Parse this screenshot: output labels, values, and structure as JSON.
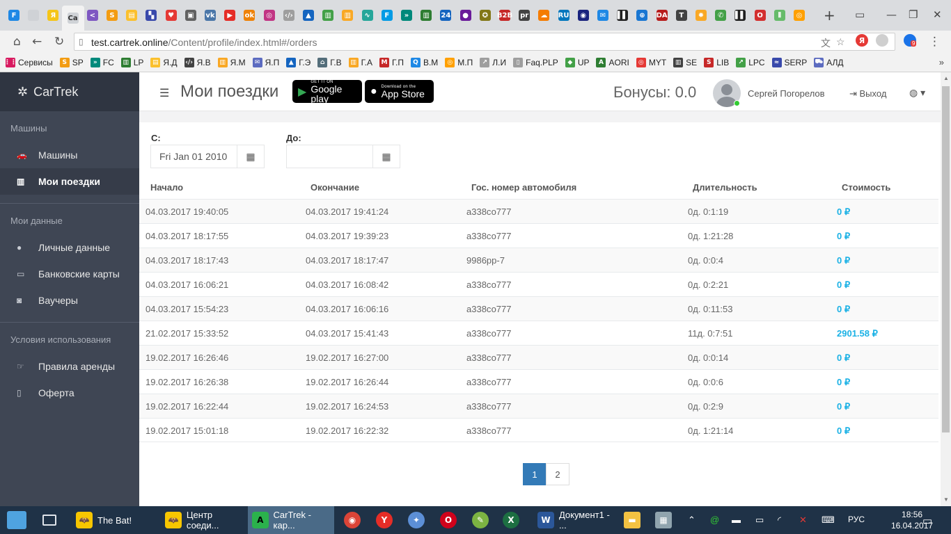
{
  "browser": {
    "url_host": "test.cartrek.online",
    "url_path": "/Content/profile/index.html#/orders",
    "active_tab_short": "Са",
    "tabs": [
      {
        "icon": "blue-square",
        "color": "#1e88e5",
        "g": "F"
      },
      {
        "icon": "page",
        "color": "#cfd2d6",
        "g": ""
      },
      {
        "icon": "yandex",
        "color": "#f5c518",
        "g": "Я"
      },
      {
        "icon": "cartrek",
        "color": "#cfd2d6",
        "g": "Са"
      },
      {
        "icon": "share",
        "color": "#7e57c2",
        "g": "<"
      },
      {
        "icon": "s-orange",
        "color": "#f39c12",
        "g": "S"
      },
      {
        "icon": "yellow-doc",
        "color": "#fbc02d",
        "g": "▤"
      },
      {
        "icon": "uploader",
        "color": "#3949ab",
        "g": "▚"
      },
      {
        "icon": "red-logo",
        "color": "#e53935",
        "g": "♥"
      },
      {
        "icon": "box",
        "color": "#616161",
        "g": "▣"
      },
      {
        "icon": "vk",
        "color": "#4a76a8",
        "g": "vk"
      },
      {
        "icon": "youtube",
        "color": "#e52d27",
        "g": "▶"
      },
      {
        "icon": "odnoklassniki",
        "color": "#ee8208",
        "g": "ok"
      },
      {
        "icon": "instagram",
        "color": "#c13584",
        "g": "◎"
      },
      {
        "icon": "code",
        "color": "#9e9e9e",
        "g": "‹/›"
      },
      {
        "icon": "triangle",
        "color": "#1565c0",
        "g": "▲"
      },
      {
        "icon": "bars-color",
        "color": "#43a047",
        "g": "▥"
      },
      {
        "icon": "bars-yellow",
        "color": "#f9a825",
        "g": "▥"
      },
      {
        "icon": "pulse",
        "color": "#26a69a",
        "g": "∿"
      },
      {
        "icon": "f-box",
        "color": "#039be5",
        "g": "F"
      },
      {
        "icon": "chevrons",
        "color": "#00897b",
        "g": "»"
      },
      {
        "icon": "bars-green",
        "color": "#2e7d32",
        "g": "▥"
      },
      {
        "icon": "24",
        "color": "#1565c0",
        "g": "24"
      },
      {
        "icon": "circle-purple",
        "color": "#6a1b9a",
        "g": "●"
      },
      {
        "icon": "badge",
        "color": "#827717",
        "g": "✪"
      },
      {
        "icon": "b2b",
        "color": "#c62828",
        "g": "B2B"
      },
      {
        "icon": "pr",
        "color": "#424242",
        "g": "pr"
      },
      {
        "icon": "cloud",
        "color": "#f57c00",
        "g": "☁"
      },
      {
        "icon": "ru",
        "color": "#0277bd",
        "g": "RU"
      },
      {
        "icon": "circle-logo",
        "color": "#1a237e",
        "g": "◉"
      },
      {
        "icon": "mail",
        "color": "#1e88e5",
        "g": "✉"
      },
      {
        "icon": "black-box",
        "color": "#212121",
        "g": "▌▌"
      },
      {
        "icon": "plus-circle",
        "color": "#1976d2",
        "g": "⊕"
      },
      {
        "icon": "da",
        "color": "#b71c1c",
        "g": "DA"
      },
      {
        "icon": "t-circle",
        "color": "#424242",
        "g": "T"
      },
      {
        "icon": "gear-yellow",
        "color": "#f9a825",
        "g": "✹"
      },
      {
        "icon": "whatsapp",
        "color": "#43a047",
        "g": "✆"
      },
      {
        "icon": "black-ii",
        "color": "#212121",
        "g": "▌▌"
      },
      {
        "icon": "opera-red",
        "color": "#d32f2f",
        "g": "O"
      },
      {
        "icon": "green-bars",
        "color": "#66bb6a",
        "g": "⫴"
      },
      {
        "icon": "orange-o",
        "color": "#ffa000",
        "g": "◎"
      }
    ],
    "new_tab": "+",
    "window_controls": [
      "▭",
      "—",
      "❐",
      "✕"
    ],
    "bookmarks": [
      {
        "label": "Сервисы",
        "color": "#d81b60",
        "g": "⋮⋮"
      },
      {
        "label": "SP",
        "color": "#f39c12",
        "g": "S"
      },
      {
        "label": "FC",
        "color": "#00897b",
        "g": "»"
      },
      {
        "label": "LP",
        "color": "#2e7d32",
        "g": "▥"
      },
      {
        "label": "Я.Д",
        "color": "#fbc02d",
        "g": "▤"
      },
      {
        "label": "Я.В",
        "color": "#424242",
        "g": "‹/›"
      },
      {
        "label": "Я.М",
        "color": "#f9a825",
        "g": "▥"
      },
      {
        "label": "Я.П",
        "color": "#5c6bc0",
        "g": "✉"
      },
      {
        "label": "Г.Э",
        "color": "#1565c0",
        "g": "▲"
      },
      {
        "label": "Г.В",
        "color": "#546e7a",
        "g": "⌂"
      },
      {
        "label": "Г.А",
        "color": "#f9a825",
        "g": "▥"
      },
      {
        "label": "Г.П",
        "color": "#c62828",
        "g": "M"
      },
      {
        "label": "В.М",
        "color": "#1e88e5",
        "g": "Q"
      },
      {
        "label": "М.П",
        "color": "#ffa000",
        "g": "◎"
      },
      {
        "label": "Л.И",
        "color": "#9e9e9e",
        "g": "↗"
      },
      {
        "label": "Faq.PLP",
        "color": "#9e9e9e",
        "g": "▯"
      },
      {
        "label": "UP",
        "color": "#43a047",
        "g": "◆"
      },
      {
        "label": "AORI",
        "color": "#2e7d32",
        "g": "A"
      },
      {
        "label": "MYT",
        "color": "#e53935",
        "g": "◎"
      },
      {
        "label": "SE",
        "color": "#424242",
        "g": "▥"
      },
      {
        "label": "LIB",
        "color": "#c62828",
        "g": "S"
      },
      {
        "label": "LPC",
        "color": "#43a047",
        "g": "↗"
      },
      {
        "label": "SERP",
        "color": "#3949ab",
        "g": "≈"
      },
      {
        "label": "АЛД",
        "color": "#5c6bc0",
        "g": "⛟"
      }
    ],
    "bookmarks_more": "»",
    "ext_badge": "9"
  },
  "sidebar": {
    "logo": "CarTrek",
    "groups": [
      {
        "title": "Машины",
        "items": [
          {
            "label": "Машины",
            "icon": "car-icon",
            "g": "🚗",
            "active": false
          },
          {
            "label": "Мои поездки",
            "icon": "chart-icon",
            "g": "▥",
            "active": true
          }
        ]
      },
      {
        "title": "Мои данные",
        "items": [
          {
            "label": "Личные данные",
            "icon": "user-icon",
            "g": "●",
            "active": false
          },
          {
            "label": "Банковские карты",
            "icon": "card-icon",
            "g": "▭",
            "active": false
          },
          {
            "label": "Ваучеры",
            "icon": "voucher-icon",
            "g": "◙",
            "active": false
          }
        ]
      },
      {
        "title": "Условия использования",
        "items": [
          {
            "label": "Правила аренды",
            "icon": "hand-icon",
            "g": "☞",
            "active": false
          },
          {
            "label": "Оферта",
            "icon": "document-icon",
            "g": "▯",
            "active": false
          }
        ]
      }
    ]
  },
  "header": {
    "title": "Мои поездки",
    "google_play_small": "GET IT ON",
    "google_play_big": "Google play",
    "app_store_small": "Download on the",
    "app_store_big": "App Store",
    "bonus": "Бонусы: 0.0",
    "user_name": "Сергей Погорелов",
    "logout": "Выход"
  },
  "filter": {
    "from_label": "С:",
    "from_value": "Fri Jan 01 2010",
    "to_label": "До:",
    "to_value": ""
  },
  "table": {
    "columns": [
      "Начало",
      "Окончание",
      "Гос. номер автомобиля",
      "Длительность",
      "Стоимость"
    ],
    "rows": [
      [
        "04.03.2017 19:40:05",
        "04.03.2017 19:41:24",
        "а338со777",
        "0д. 0:1:19",
        "0 ₽"
      ],
      [
        "04.03.2017 18:17:55",
        "04.03.2017 19:39:23",
        "а338со777",
        "0д. 1:21:28",
        "0 ₽"
      ],
      [
        "04.03.2017 18:17:43",
        "04.03.2017 18:17:47",
        "9986рр-7",
        "0д. 0:0:4",
        "0 ₽"
      ],
      [
        "04.03.2017 16:06:21",
        "04.03.2017 16:08:42",
        "а338со777",
        "0д. 0:2:21",
        "0 ₽"
      ],
      [
        "04.03.2017 15:54:23",
        "04.03.2017 16:06:16",
        "а338со777",
        "0д. 0:11:53",
        "0 ₽"
      ],
      [
        "21.02.2017 15:33:52",
        "04.03.2017 15:41:43",
        "а338со777",
        "11д. 0:7:51",
        "2901.58 ₽"
      ],
      [
        "19.02.2017 16:26:46",
        "19.02.2017 16:27:00",
        "а338со777",
        "0д. 0:0:14",
        "0 ₽"
      ],
      [
        "19.02.2017 16:26:38",
        "19.02.2017 16:26:44",
        "а338со777",
        "0д. 0:0:6",
        "0 ₽"
      ],
      [
        "19.02.2017 16:22:44",
        "19.02.2017 16:24:53",
        "а338со777",
        "0д. 0:2:9",
        "0 ₽"
      ],
      [
        "19.02.2017 15:01:18",
        "19.02.2017 16:22:32",
        "а338со777",
        "0д. 1:21:14",
        "0 ₽"
      ]
    ]
  },
  "pagination": {
    "pages": [
      "1",
      "2"
    ],
    "active": "1"
  },
  "taskbar": {
    "windows": [
      {
        "label": "The Bat!",
        "color": "#f7c600",
        "g": "🦇",
        "active": false
      },
      {
        "label": "Центр соеди...",
        "color": "#f7c600",
        "g": "🦇",
        "active": false
      },
      {
        "label": "CarTrek - кар...",
        "color": "#2bb24c",
        "g": "A",
        "active": true
      }
    ],
    "pinned": [
      {
        "name": "chrome-icon",
        "color": "#db4437",
        "g": "◉"
      },
      {
        "name": "yandex-browser-icon",
        "color": "#e52d27",
        "g": "Y"
      },
      {
        "name": "safari-icon",
        "color": "#5c8fd6",
        "g": "✦"
      },
      {
        "name": "opera-icon",
        "color": "#d0021b",
        "g": "O"
      },
      {
        "name": "notepad-icon",
        "color": "#7cb342",
        "g": "✎"
      },
      {
        "name": "excel-icon",
        "color": "#1d6f42",
        "g": "X"
      }
    ],
    "word_window": "Документ1 - ...",
    "tray_lang": "РУС",
    "time": "18:56",
    "date": "16.04.2017"
  }
}
